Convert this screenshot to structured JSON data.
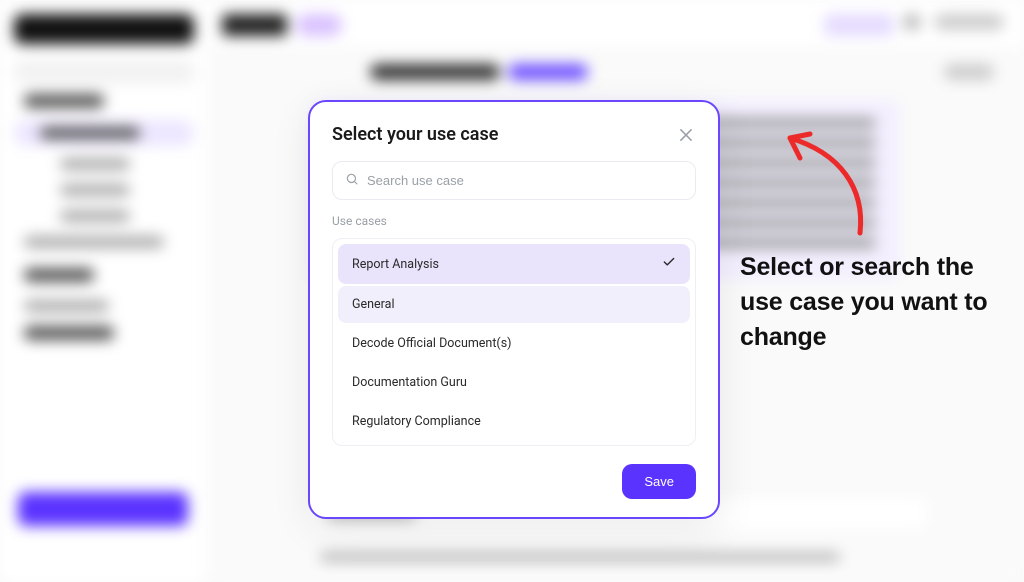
{
  "modal": {
    "title": "Select your use case",
    "search_placeholder": "Search use case",
    "section_label": "Use cases",
    "items": [
      {
        "label": "Report Analysis",
        "selected": true
      },
      {
        "label": "General",
        "highlighted": true
      },
      {
        "label": "Decode Official Document(s)"
      },
      {
        "label": "Documentation Guru"
      },
      {
        "label": "Regulatory Compliance"
      }
    ],
    "save_label": "Save"
  },
  "annotation": {
    "text": "Select or search the use case you want to change"
  },
  "colors": {
    "accent": "#5b33ff",
    "modal_border": "#6b46ff",
    "annotation_red": "#ed2a2a"
  }
}
